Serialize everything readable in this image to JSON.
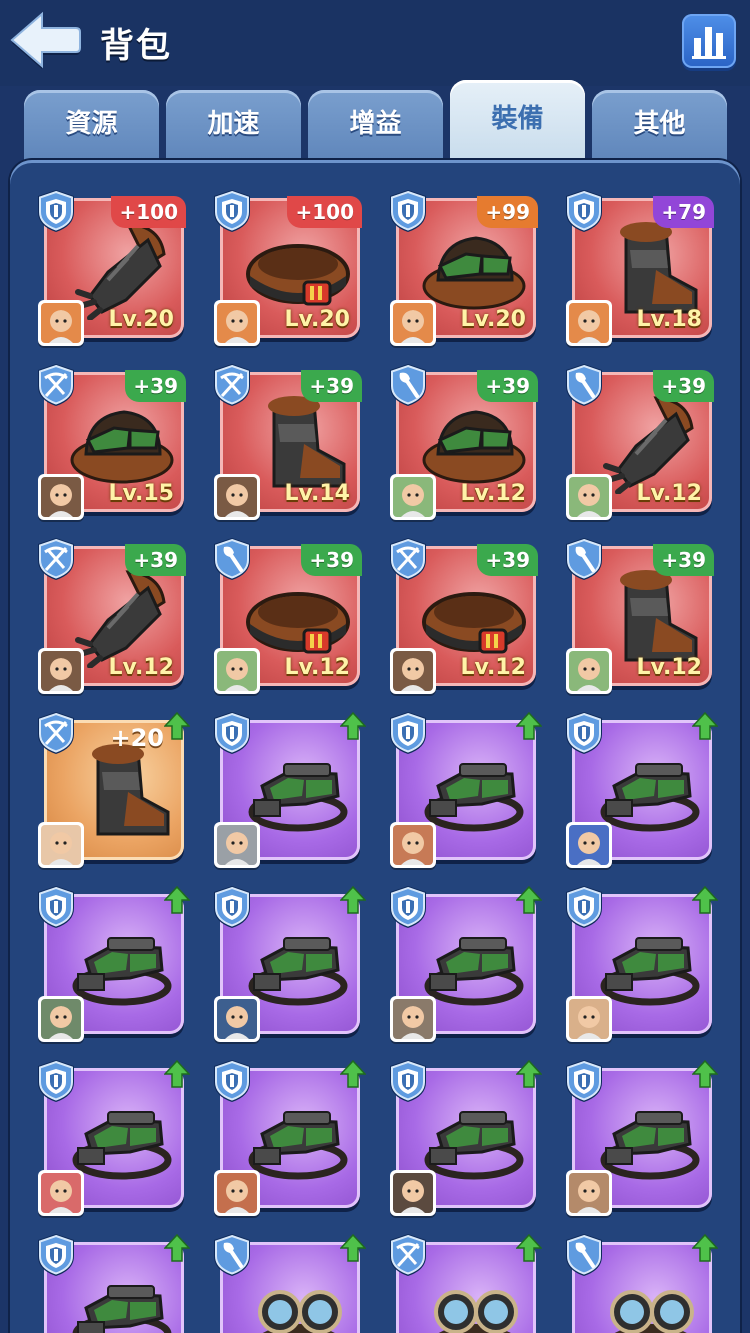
{
  "header": {
    "title": "背包",
    "back_icon": "back-arrow-icon",
    "stats_icon": "bar-chart-icon"
  },
  "tabs": [
    {
      "label": "資源",
      "active": false
    },
    {
      "label": "加速",
      "active": false
    },
    {
      "label": "增益",
      "active": false
    },
    {
      "label": "裝備",
      "active": true
    },
    {
      "label": "其他",
      "active": false
    }
  ],
  "items": [
    {
      "type": "shield",
      "bonus": "+100",
      "bonus_color": "red",
      "level": "Lv.20",
      "rarity": "red",
      "art": "gauntlet",
      "hero": "#e48a4a"
    },
    {
      "type": "shield",
      "bonus": "+100",
      "bonus_color": "red",
      "level": "Lv.20",
      "rarity": "red",
      "art": "belt",
      "hero": "#e48a4a"
    },
    {
      "type": "shield",
      "bonus": "+99",
      "bonus_color": "orange",
      "level": "Lv.20",
      "rarity": "red",
      "art": "goggles-hat",
      "hero": "#e48a4a"
    },
    {
      "type": "shield",
      "bonus": "+79",
      "bonus_color": "purple",
      "level": "Lv.18",
      "rarity": "red",
      "art": "boot",
      "hero": "#e48a4a"
    },
    {
      "type": "crossbow",
      "bonus": "+39",
      "bonus_color": "green",
      "level": "Lv.15",
      "rarity": "red",
      "art": "goggles-hat",
      "hero": "#7a5a44"
    },
    {
      "type": "crossbow",
      "bonus": "+39",
      "bonus_color": "green",
      "level": "Lv.14",
      "rarity": "red",
      "art": "boot",
      "hero": "#7a5a44"
    },
    {
      "type": "shovel",
      "bonus": "+39",
      "bonus_color": "green",
      "level": "Lv.12",
      "rarity": "red",
      "art": "goggles-hat",
      "hero": "#8ab87a"
    },
    {
      "type": "shovel",
      "bonus": "+39",
      "bonus_color": "green",
      "level": "Lv.12",
      "rarity": "red",
      "art": "gauntlet",
      "hero": "#8ab87a"
    },
    {
      "type": "crossbow",
      "bonus": "+39",
      "bonus_color": "green",
      "level": "Lv.12",
      "rarity": "red",
      "art": "gauntlet",
      "hero": "#7a5a44"
    },
    {
      "type": "shovel",
      "bonus": "+39",
      "bonus_color": "green",
      "level": "Lv.12",
      "rarity": "red",
      "art": "belt",
      "hero": "#8ab87a"
    },
    {
      "type": "crossbow",
      "bonus": "+39",
      "bonus_color": "green",
      "level": "Lv.12",
      "rarity": "red",
      "art": "belt",
      "hero": "#7a5a44"
    },
    {
      "type": "shovel",
      "bonus": "+39",
      "bonus_color": "green",
      "level": "Lv.12",
      "rarity": "red",
      "art": "boot",
      "hero": "#8ab87a"
    },
    {
      "type": "crossbow",
      "bonus": "+20",
      "bonus_color": "plain",
      "level": "",
      "rarity": "orange",
      "art": "boot",
      "hero": "#e8c7a8",
      "upgrade": true
    },
    {
      "type": "shield",
      "bonus": "",
      "level": "",
      "rarity": "purple",
      "art": "goggles",
      "hero": "#9aa0a6",
      "upgrade": true
    },
    {
      "type": "shield",
      "bonus": "",
      "level": "",
      "rarity": "purple",
      "art": "goggles",
      "hero": "#c77a56",
      "upgrade": true
    },
    {
      "type": "shield",
      "bonus": "",
      "level": "",
      "rarity": "purple",
      "art": "goggles",
      "hero": "#4a6fc4",
      "upgrade": true
    },
    {
      "type": "shield",
      "bonus": "",
      "level": "",
      "rarity": "purple",
      "art": "goggles",
      "hero": "#6f8a6a",
      "upgrade": true
    },
    {
      "type": "shield",
      "bonus": "",
      "level": "",
      "rarity": "purple",
      "art": "goggles",
      "hero": "#3d5f8f",
      "upgrade": true
    },
    {
      "type": "shield",
      "bonus": "",
      "level": "",
      "rarity": "purple",
      "art": "goggles",
      "hero": "#8a7a6a",
      "upgrade": true
    },
    {
      "type": "shield",
      "bonus": "",
      "level": "",
      "rarity": "purple",
      "art": "goggles",
      "hero": "#d9b08a",
      "upgrade": true
    },
    {
      "type": "shield",
      "bonus": "",
      "level": "",
      "rarity": "purple",
      "art": "goggles",
      "hero": "#d96a6a",
      "upgrade": true
    },
    {
      "type": "shield",
      "bonus": "",
      "level": "",
      "rarity": "purple",
      "art": "goggles",
      "hero": "#c46f4d",
      "upgrade": true
    },
    {
      "type": "shield",
      "bonus": "",
      "level": "",
      "rarity": "purple",
      "art": "goggles",
      "hero": "#5b4a3f",
      "upgrade": true
    },
    {
      "type": "shield",
      "bonus": "",
      "level": "",
      "rarity": "purple",
      "art": "goggles",
      "hero": "#b48a6a",
      "upgrade": true
    },
    {
      "type": "shield",
      "bonus": "",
      "level": "",
      "rarity": "purple",
      "art": "goggles",
      "hero": "#777777",
      "upgrade": true
    },
    {
      "type": "shovel",
      "bonus": "",
      "level": "",
      "rarity": "purple",
      "art": "round-goggles",
      "hero": "#777777",
      "upgrade": true
    },
    {
      "type": "crossbow",
      "bonus": "",
      "level": "",
      "rarity": "purple",
      "art": "round-goggles",
      "hero": "#777777",
      "upgrade": true
    },
    {
      "type": "shovel",
      "bonus": "",
      "level": "",
      "rarity": "purple",
      "art": "round-goggles",
      "hero": "#777777",
      "upgrade": true
    }
  ]
}
